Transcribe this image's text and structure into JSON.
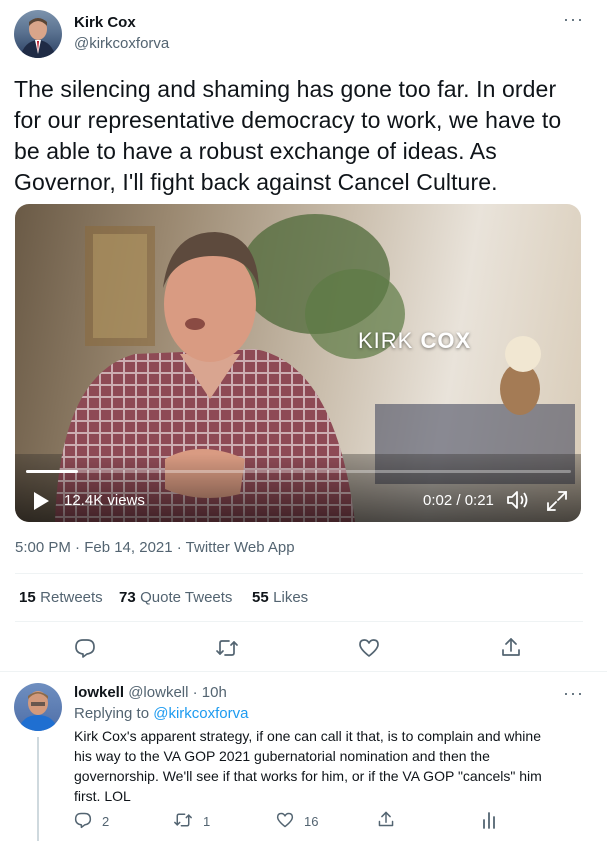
{
  "tweet": {
    "author_name": "Kirk Cox",
    "author_handle": "@kirkcoxforva",
    "text_lines": [
      "The silencing and shaming has gone too far. In order",
      "for our representative democracy to work, we have to",
      "be able to have a robust exchange of ideas. As",
      "Governor, I'll fight back against Cancel Culture."
    ],
    "video": {
      "overlay_first": "KIRK ",
      "overlay_last": "COX",
      "views": "12.4K views",
      "time": "0:02 / 0:21",
      "progress": 0.095
    },
    "timestamp": "5:00 PM · Feb 14, 2021 · Twitter Web App",
    "stats": {
      "retweets_count": "15",
      "retweets_label": "Retweets",
      "quotes_count": "73",
      "quotes_label": "Quote Tweets",
      "likes_count": "55",
      "likes_label": "Likes"
    }
  },
  "reply": {
    "author_name": "lowkell",
    "author_handle": "@lowkell",
    "time": "· 10h",
    "replying_prefix": "Replying to ",
    "replying_handle": "@kirkcoxforva",
    "text_lines": [
      "Kirk Cox's apparent strategy, if one can call it that, is to complain and whine",
      "his way to the VA GOP 2021 gubernatorial nomination and then the",
      "governorship.  We'll see if that works for him, or if the VA GOP \"cancels\" him",
      "first. LOL"
    ],
    "counts": {
      "replies": "2",
      "retweets": "1",
      "likes": "16"
    }
  },
  "icons": {
    "more": "more-dots-icon",
    "reply": "comment-icon",
    "retweet": "retweet-icon",
    "like": "heart-icon",
    "share": "share-icon",
    "play": "play-icon",
    "volume": "volume-icon",
    "fullscreen": "fullscreen-icon",
    "analytics": "analytics-icon"
  },
  "colors": {
    "accent": "#1d9bf0",
    "text": "#0f1419",
    "muted": "#536471"
  }
}
